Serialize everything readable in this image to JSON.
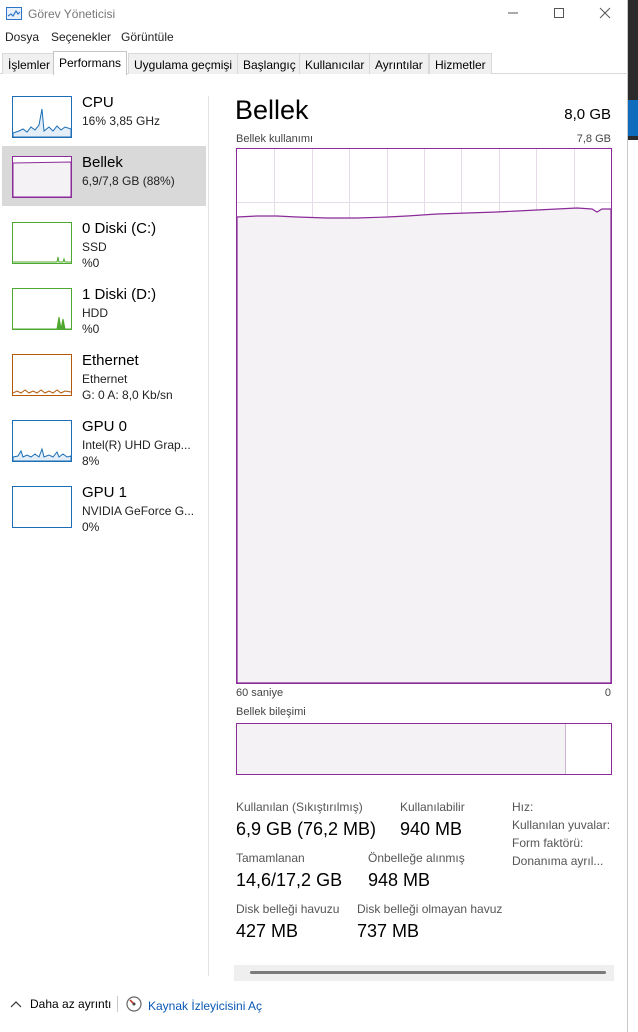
{
  "window": {
    "title": "Görev Yöneticisi",
    "controls": [
      "minimize-icon",
      "maximize-icon",
      "close-icon"
    ]
  },
  "menu": [
    "Dosya",
    "Seçenekler",
    "Görüntüle"
  ],
  "tabs": [
    {
      "label": "İşlemler",
      "active": false
    },
    {
      "label": "Performans",
      "active": true
    },
    {
      "label": "Uygulama geçmişi",
      "active": false
    },
    {
      "label": "Başlangıç",
      "active": false
    },
    {
      "label": "Kullanıcılar",
      "active": false
    },
    {
      "label": "Ayrıntılar",
      "active": false
    },
    {
      "label": "Hizmetler",
      "active": false
    }
  ],
  "sidebar": {
    "items": [
      {
        "name": "CPU",
        "line1": "16% 3,85 GHz",
        "line2": "",
        "color": "#1c6fb5",
        "selected": false
      },
      {
        "name": "Bellek",
        "line1": "6,9/7,8 GB (88%)",
        "line2": "",
        "color": "#8b2a99",
        "selected": true
      },
      {
        "name": "0 Diski (C:)",
        "line1": "SSD",
        "line2": "%0",
        "color": "#4ea72e",
        "selected": false
      },
      {
        "name": "1 Diski (D:)",
        "line1": "HDD",
        "line2": "%0",
        "color": "#4ea72e",
        "selected": false
      },
      {
        "name": "Ethernet",
        "line1": "Ethernet",
        "line2": "G: 0 A: 8,0 Kb/sn",
        "color": "#b2590c",
        "selected": false
      },
      {
        "name": "GPU 0",
        "line1": "Intel(R) UHD Grap...",
        "line2": "8%",
        "color": "#1c6fb5",
        "selected": false
      },
      {
        "name": "GPU 1",
        "line1": "NVIDIA GeForce G...",
        "line2": "0%",
        "color": "#1c6fb5",
        "selected": false
      }
    ]
  },
  "main": {
    "title": "Bellek",
    "total": "8,0 GB",
    "usage_label": "Bellek kullanımı",
    "usage_max": "7,8 GB",
    "time_left": "60 saniye",
    "time_right": "0",
    "composition_label": "Bellek bileşimi",
    "usage_fraction": 0.88,
    "stats": [
      {
        "label": "Kullanılan (Sıkıştırılmış)",
        "value": "6,9 GB (76,2 MB)"
      },
      {
        "label": "Kullanılabilir",
        "value": "940 MB"
      },
      {
        "label": "Tamamlanan",
        "value": "14,6/17,2 GB"
      },
      {
        "label": "Önbelleğe alınmış",
        "value": "948 MB"
      },
      {
        "label": "Disk belleği havuzu",
        "value": "427 MB"
      },
      {
        "label": "Disk belleği olmayan havuz",
        "value": "737 MB"
      }
    ],
    "properties": [
      "Hız:",
      "Kullanılan yuvalar:",
      "Form faktörü:",
      "Donanıma ayrıl..."
    ]
  },
  "footer": {
    "less_details": "Daha az ayrıntı",
    "resource_monitor": "Kaynak İzleyicisini Aç"
  }
}
